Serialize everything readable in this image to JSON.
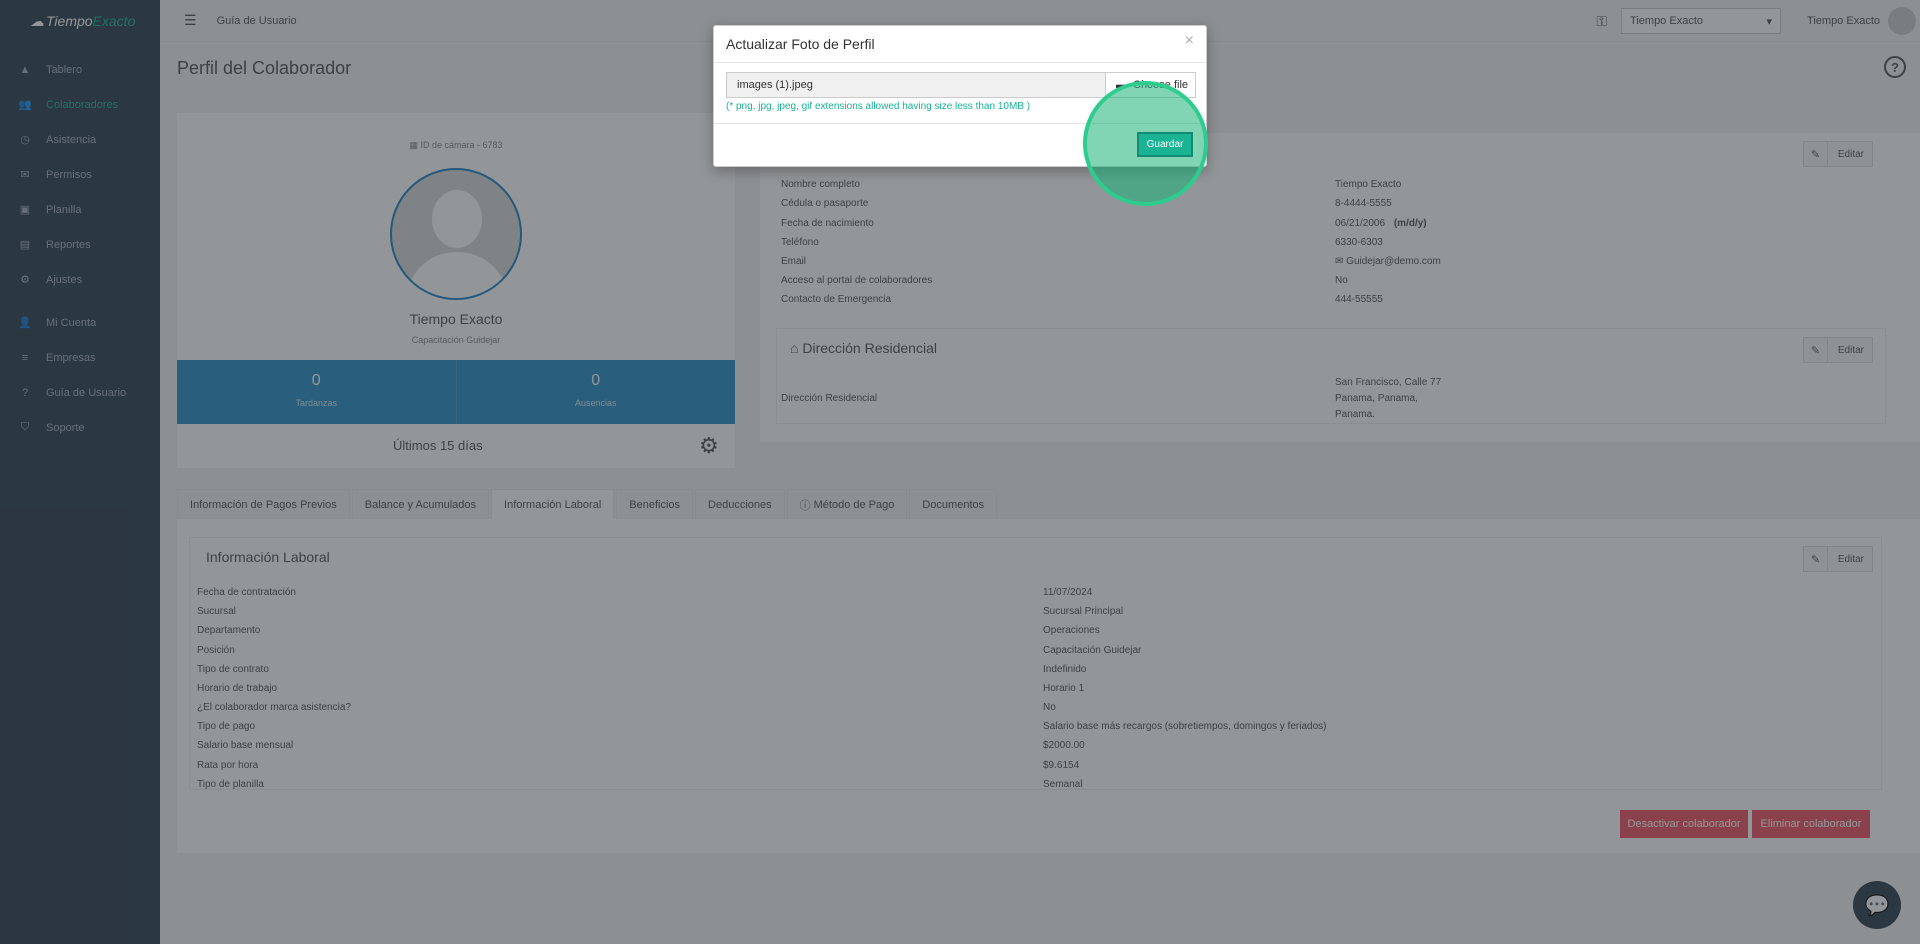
{
  "app": {
    "brand_part1": "Tiempo",
    "brand_part2": "Exacto"
  },
  "sidebar": {
    "items": [
      {
        "label": "Tablero",
        "icon": "dashboard-icon",
        "glyph": "▲"
      },
      {
        "label": "Colaboradores",
        "icon": "users-icon",
        "glyph": "👥"
      },
      {
        "label": "Asistencia",
        "icon": "clock-icon",
        "glyph": "◷"
      },
      {
        "label": "Permisos",
        "icon": "envelope-icon",
        "glyph": "✉"
      },
      {
        "label": "Planilla",
        "icon": "money-icon",
        "glyph": "▣"
      },
      {
        "label": "Reportes",
        "icon": "file-icon",
        "glyph": "▤"
      },
      {
        "label": "Ajustes",
        "icon": "cog-icon",
        "glyph": "⚙"
      },
      {
        "label": "Mi Cuenta",
        "icon": "user-icon",
        "glyph": "👤"
      },
      {
        "label": "Empresas",
        "icon": "sliders-icon",
        "glyph": "≡"
      },
      {
        "label": "Guía de Usuario",
        "icon": "question-icon",
        "glyph": "?"
      },
      {
        "label": "Soporte",
        "icon": "shield-icon",
        "glyph": "⛉"
      }
    ]
  },
  "topbar": {
    "guide": "Guía de Usuario",
    "company_select": "Tiempo Exacto",
    "user_name": "Tiempo Exacto"
  },
  "page": {
    "title": "Perfil del Colaborador"
  },
  "profile": {
    "id_line": "ID de cámara - 6783",
    "name": "Tiempo Exacto",
    "role": "Capacitación Guidejar",
    "stat1_value": "0",
    "stat1_label": "Tardanzas",
    "stat2_value": "0",
    "stat2_label": "Ausencias",
    "last_days": "Últimos 15 días"
  },
  "personal": {
    "edit_label": "Editar",
    "rows": [
      {
        "k": "Nombre completo",
        "v": "Tiempo Exacto"
      },
      {
        "k": "Cédula o pasaporte",
        "v": "8-4444-5555"
      },
      {
        "k": "Fecha de nacimiento",
        "v": "06/21/2006"
      },
      {
        "k": "Teléfono",
        "v": "6330-6303"
      },
      {
        "k": "Email",
        "v": "Guidejar@demo.com"
      },
      {
        "k": "Acceso al portal de colaboradores",
        "v": "No"
      },
      {
        "k": "Contacto de Emergencia",
        "v": "444-55555"
      }
    ],
    "date_format": "(m/d/y)"
  },
  "address": {
    "title": "Dirección Residencial",
    "edit_label": "Editar",
    "key": "Dirección Residencial",
    "line1": "San Francisco, Calle 77",
    "line2": "Panama, Panama,",
    "line3": "Panama."
  },
  "tabs": [
    {
      "label": "Información de Pagos Previos"
    },
    {
      "label": "Balance y Acumulados"
    },
    {
      "label": "Información Laboral"
    },
    {
      "label": "Beneficios"
    },
    {
      "label": "Deducciones"
    },
    {
      "label": "Método de Pago"
    },
    {
      "label": "Documentos"
    }
  ],
  "labor": {
    "title": "Información Laboral",
    "edit_label": "Editar",
    "rows": [
      {
        "k": "Fecha de contratación",
        "v": "11/07/2024"
      },
      {
        "k": "Sucursal",
        "v": "Sucursal Principal"
      },
      {
        "k": "Departamento",
        "v": "Operaciones"
      },
      {
        "k": "Posición",
        "v": "Capacitación Guidejar"
      },
      {
        "k": "Tipo de contrato",
        "v": "Indefinido"
      },
      {
        "k": "Horario de trabajo",
        "v": "Horario 1"
      },
      {
        "k": "¿El colaborador marca asistencia?",
        "v": "No"
      },
      {
        "k": "Tipo de pago",
        "v": "Salario base más recargos (sobretiempos, domingos y feriados)"
      },
      {
        "k": "Salario base mensual",
        "v": "$2000.00"
      },
      {
        "k": "Rata por hora",
        "v": "$9.6154"
      },
      {
        "k": "Tipo de planilla",
        "v": "Semanal"
      }
    ],
    "deactivate": "Desactivar colaborador",
    "delete": "Eliminar colaborador"
  },
  "modal": {
    "title": "Actualizar Foto de Perfil",
    "close": "×",
    "file_value": "images (1).jpeg",
    "choose_file": "Choose file",
    "note": "(* png, jpg, jpeg, gif extensions allowed having size less than 10MB )",
    "save": "Guardar"
  }
}
